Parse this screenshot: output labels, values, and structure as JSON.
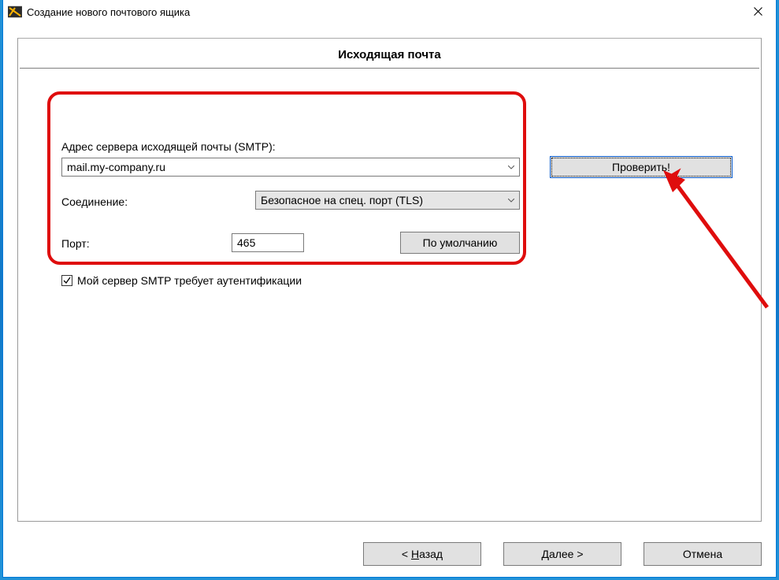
{
  "window": {
    "title": "Создание нового почтового ящика"
  },
  "page": {
    "heading": "Исходящая почта"
  },
  "form": {
    "smtp_label": "Адрес сервера исходящей почты (SMTP):",
    "smtp_value": "mail.my-company.ru",
    "connection_label": "Соединение:",
    "connection_value": "Безопасное на спец. порт (TLS)",
    "port_label": "Порт:",
    "port_value": "465",
    "default_button": "По умолчанию",
    "auth_checked": true,
    "auth_label": "Мой сервер SMTP требует аутентификации",
    "test_button": "Проверить!"
  },
  "footer": {
    "back_prefix": "<  ",
    "back_key": "Н",
    "back_rest": "азад",
    "next_key": "Д",
    "next_rest": "алее  >",
    "cancel": "Отмена"
  },
  "annotation": {
    "arrow_color": "#df0d0d"
  }
}
